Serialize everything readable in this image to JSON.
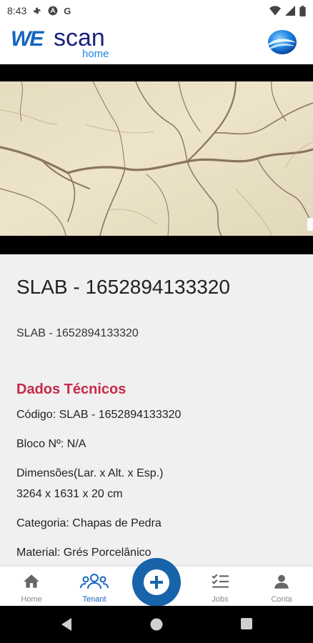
{
  "status_bar": {
    "time": "8:43",
    "left_icons": [
      "gear-icon",
      "a-circle-icon",
      "g-icon"
    ],
    "right_icons": [
      "wifi-icon",
      "signal-icon",
      "battery-icon"
    ]
  },
  "header": {
    "logo_we": "WE",
    "logo_scan": "scan",
    "logo_home": "home",
    "accent": "#1565c0"
  },
  "slab": {
    "title": "SLAB - 1652894133320",
    "subtitle": "SLAB - 1652894133320"
  },
  "dados": {
    "title": "Dados Técnicos",
    "title_color": "#c62848",
    "codigo": "Código: SLAB - 1652894133320",
    "bloco": "Bloco Nº: N/A",
    "dimensoes_label": "Dimensões(Lar. x Alt. x Esp.)",
    "dimensoes_value": "3264 x 1631 x 20 cm",
    "categoria": "Categoria: Chapas de Pedra",
    "material": "Material: Grés Porcelânico"
  },
  "bottom_nav": {
    "items": [
      {
        "label": "Home",
        "icon": "home-icon",
        "active": false
      },
      {
        "label": "Tenant",
        "icon": "people-icon",
        "active": true
      },
      {
        "label": "Jobs",
        "icon": "checklist-icon",
        "active": false
      },
      {
        "label": "Conta",
        "icon": "person-icon",
        "active": false
      }
    ],
    "fab_icon": "plus-icon"
  },
  "system_nav": [
    "back-icon",
    "home-circle-icon",
    "recents-icon"
  ]
}
